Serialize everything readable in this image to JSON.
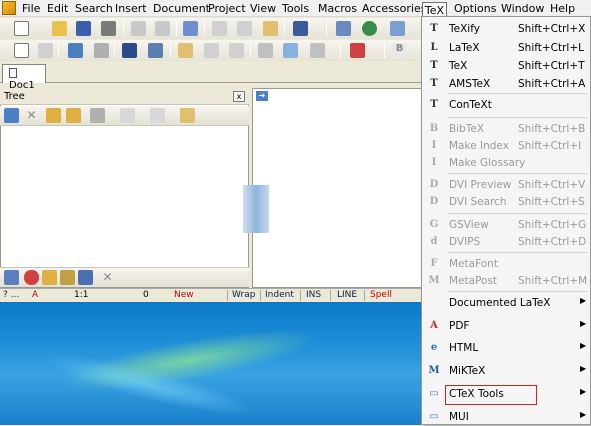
{
  "menubar": {
    "items": [
      "File",
      "Edit",
      "Search",
      "Insert",
      "Document",
      "Project",
      "View",
      "Tools",
      "Macros",
      "Accessories",
      "TeX",
      "Options",
      "Window",
      "Help"
    ],
    "active": "TeX"
  },
  "document_tab": {
    "label": "Doc1"
  },
  "tree_panel": {
    "title": "Tree",
    "close_glyph": "☒"
  },
  "status_bar": {
    "help": "? ...",
    "mode": "A",
    "position": "1:1",
    "count": "0",
    "new_flag": "New",
    "wrap": "Wrap",
    "indent": "Indent",
    "ins": "INS",
    "line": "LINE",
    "spell": "Spell"
  },
  "tex_menu": {
    "items": [
      {
        "label": "TeXify",
        "shortcut": "Shift+Ctrl+X",
        "icon": "texify-icon",
        "glyph": "T",
        "enabled": true
      },
      {
        "label": "LaTeX",
        "shortcut": "Shift+Ctrl+L",
        "icon": "latex-icon",
        "glyph": "L",
        "enabled": true
      },
      {
        "label": "TeX",
        "shortcut": "Shift+Ctrl+T",
        "icon": "tex-icon",
        "glyph": "T",
        "enabled": true
      },
      {
        "label": "AMSTeX",
        "shortcut": "Shift+Ctrl+A",
        "icon": "amstex-icon",
        "glyph": "T",
        "enabled": true
      },
      {
        "label": "ConTeXt",
        "shortcut": "",
        "icon": "context-icon",
        "glyph": "T",
        "enabled": true
      },
      {
        "label": "BibTeX",
        "shortcut": "Shift+Ctrl+B",
        "icon": "bibtex-icon",
        "glyph": "B",
        "enabled": false
      },
      {
        "label": "Make Index",
        "shortcut": "Shift+Ctrl+I",
        "icon": "makeindex-icon",
        "glyph": "I",
        "enabled": false
      },
      {
        "label": "Make Glossary",
        "shortcut": "",
        "icon": "makeglossary-icon",
        "glyph": "I",
        "enabled": false
      },
      {
        "label": "DVI Preview",
        "shortcut": "Shift+Ctrl+V",
        "icon": "dvi-preview-icon",
        "glyph": "D",
        "enabled": false
      },
      {
        "label": "DVI Search",
        "shortcut": "Shift+Ctrl+S",
        "icon": "dvi-search-icon",
        "glyph": "D",
        "enabled": false
      },
      {
        "label": "GSView",
        "shortcut": "Shift+Ctrl+G",
        "icon": "gsview-icon",
        "glyph": "G",
        "enabled": false
      },
      {
        "label": "DVIPS",
        "shortcut": "Shift+Ctrl+D",
        "icon": "dvips-icon",
        "glyph": "d",
        "enabled": false
      },
      {
        "label": "MetaFont",
        "shortcut": "",
        "icon": "metafont-icon",
        "glyph": "F",
        "enabled": false
      },
      {
        "label": "MetaPost",
        "shortcut": "Shift+Ctrl+M",
        "icon": "metapost-icon",
        "glyph": "M",
        "enabled": false
      },
      {
        "label": "Documented LaTeX",
        "shortcut": "",
        "icon": "",
        "glyph": "",
        "enabled": true,
        "submenu": true
      },
      {
        "label": "PDF",
        "shortcut": "",
        "icon": "pdf-icon",
        "glyph": "A",
        "enabled": true,
        "submenu": true
      },
      {
        "label": "HTML",
        "shortcut": "",
        "icon": "html-icon",
        "glyph": "e",
        "enabled": true,
        "submenu": true
      },
      {
        "label": "MiKTeX",
        "shortcut": "",
        "icon": "miktex-icon",
        "glyph": "M",
        "enabled": true,
        "submenu": true
      },
      {
        "label": "CTeX Tools",
        "shortcut": "",
        "icon": "ctex-tools-icon",
        "glyph": "▭",
        "enabled": true,
        "submenu": true,
        "highlighted": true
      },
      {
        "label": "MUI",
        "shortcut": "",
        "icon": "mui-icon",
        "glyph": "▭",
        "enabled": true,
        "submenu": true
      }
    ],
    "submenu_arrow": "▶"
  },
  "colors": {
    "accent_highlight": "#d22222",
    "menu_bg": "#f5f5f5",
    "disabled_text": "#9a9a9a"
  }
}
